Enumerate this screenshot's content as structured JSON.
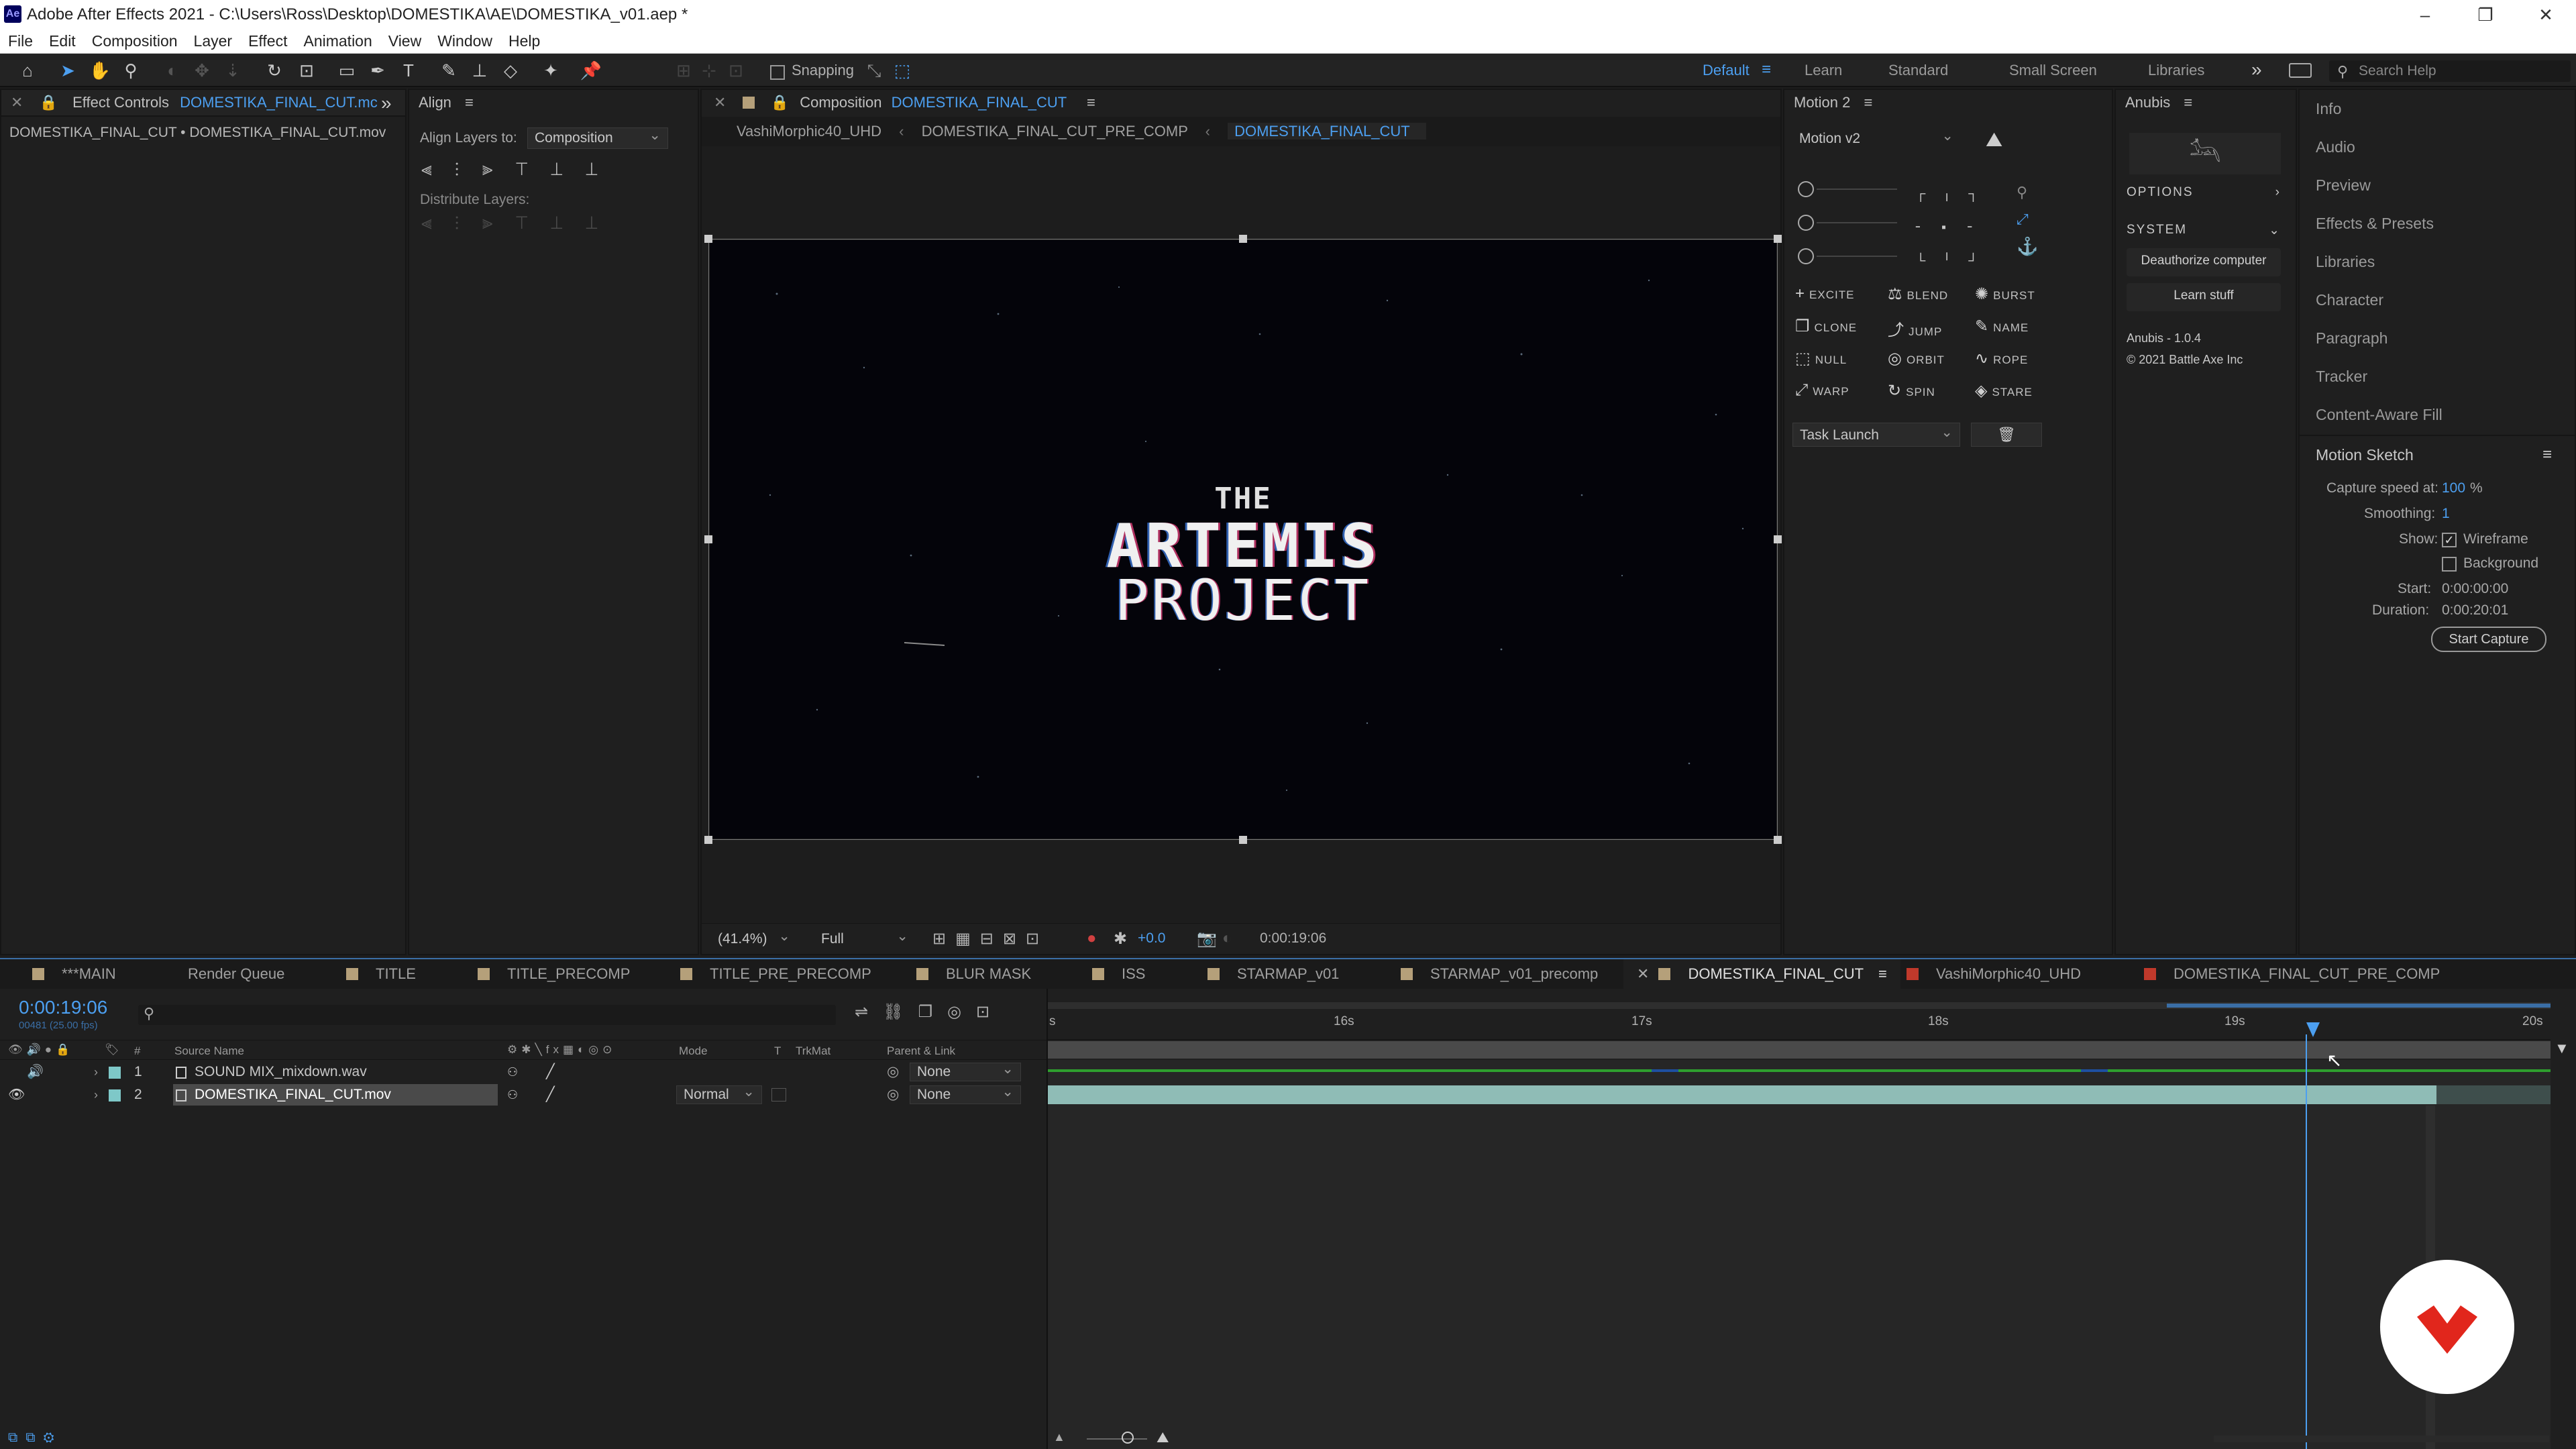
{
  "window": {
    "title": "Adobe After Effects 2021 - C:\\Users\\Ross\\Desktop\\DOMESTIKA\\AE\\DOMESTIKA_v01.aep *",
    "app_icon": "Ae",
    "minimize": "–",
    "restore": "❐",
    "close": "✕"
  },
  "menu": [
    "File",
    "Edit",
    "Composition",
    "Layer",
    "Effect",
    "Animation",
    "View",
    "Window",
    "Help"
  ],
  "toolbar": {
    "snapping": "Snapping",
    "workspaces": [
      "Default",
      "Learn",
      "Standard",
      "Small Screen",
      "Libraries"
    ],
    "active_workspace": "Default",
    "search_placeholder": "Search Help",
    "more": "»"
  },
  "effect_controls": {
    "tab_label": "Effect Controls",
    "tab_target": "DOMESTIKA_FINAL_CUT.mc",
    "subtitle": "DOMESTIKA_FINAL_CUT • DOMESTIKA_FINAL_CUT.mov"
  },
  "align": {
    "tab_label": "Align",
    "align_to_label": "Align Layers to:",
    "align_to_value": "Composition",
    "distribute_label": "Distribute Layers:"
  },
  "composition": {
    "tab_label": "Composition",
    "tab_target": "DOMESTIKA_FINAL_CUT",
    "breadcrumbs": [
      "VashiMorphic40_UHD",
      "DOMESTIKA_FINAL_CUT_PRE_COMP",
      "DOMESTIKA_FINAL_CUT"
    ],
    "active_breadcrumb": "DOMESTIKA_FINAL_CUT",
    "viewer_title_line1": "THE",
    "viewer_title_line2": "ARTEMIS",
    "viewer_title_line3": "PROJECT",
    "zoom": "(41.4%)",
    "resolution": "Full",
    "exposure": "+0.0",
    "timecode": "0:00:19:06"
  },
  "motion": {
    "tab_label": "Motion 2",
    "version": "Motion v2",
    "buttons": [
      {
        "icon": "+",
        "label": "EXCITE"
      },
      {
        "icon": "⚖",
        "label": "BLEND"
      },
      {
        "icon": "✺",
        "label": "BURST"
      },
      {
        "icon": "❐",
        "label": "CLONE"
      },
      {
        "icon": "⤴",
        "label": "JUMP"
      },
      {
        "icon": "✎",
        "label": "NAME"
      },
      {
        "icon": "⬚",
        "label": "NULL"
      },
      {
        "icon": "◎",
        "label": "ORBIT"
      },
      {
        "icon": "∿",
        "label": "ROPE"
      },
      {
        "icon": "⤢",
        "label": "WARP"
      },
      {
        "icon": "↻",
        "label": "SPIN"
      },
      {
        "icon": "◈",
        "label": "STARE"
      }
    ],
    "task_label": "Task Launch"
  },
  "anubis": {
    "tab_label": "Anubis",
    "options": "OPTIONS",
    "system": "SYSTEM",
    "deauthorize": "Deauthorize computer",
    "learn": "Learn stuff",
    "version": "Anubis - 1.0.4",
    "copyright": "© 2021 Battle Axe Inc"
  },
  "side_panels": [
    "Info",
    "Audio",
    "Preview",
    "Effects & Presets",
    "Libraries",
    "Character",
    "Paragraph",
    "Tracker",
    "Content-Aware Fill"
  ],
  "motion_sketch": {
    "title": "Motion Sketch",
    "capture_speed_label": "Capture speed at:",
    "capture_speed_value": "100",
    "capture_speed_unit": "%",
    "smoothing_label": "Smoothing:",
    "smoothing_value": "1",
    "show_label": "Show:",
    "wireframe": "Wireframe",
    "wireframe_checked": true,
    "background": "Background",
    "background_checked": false,
    "start_label": "Start:",
    "start_value": "0:00:00:00",
    "duration_label": "Duration:",
    "duration_value": "0:00:20:01",
    "start_capture": "Start Capture"
  },
  "timeline": {
    "tabs": [
      {
        "label": "MAIN",
        "prefix": "***",
        "color": "#b5a07a"
      },
      {
        "label": "Render Queue",
        "prefix": "",
        "color": ""
      },
      {
        "label": "TITLE",
        "prefix": "",
        "color": "#b5a07a"
      },
      {
        "label": "TITLE_PRECOMP",
        "prefix": "",
        "color": "#b5a07a"
      },
      {
        "label": "TITLE_PRE_PRECOMP",
        "prefix": "",
        "color": "#b5a07a"
      },
      {
        "label": "BLUR MASK",
        "prefix": "",
        "color": "#b5a07a"
      },
      {
        "label": "ISS",
        "prefix": "",
        "color": "#b5a07a"
      },
      {
        "label": "STARMAP_v01",
        "prefix": "",
        "color": "#b5a07a"
      },
      {
        "label": "STARMAP_v01_precomp",
        "prefix": "",
        "color": "#b5a07a"
      },
      {
        "label": "DOMESTIKA_FINAL_CUT",
        "prefix": "",
        "color": "#b5a07a"
      },
      {
        "label": "VashiMorphic40_UHD",
        "prefix": "",
        "color": "#c0392b"
      },
      {
        "label": "DOMESTIKA_FINAL_CUT_PRE_COMP",
        "prefix": "",
        "color": "#c0392b"
      }
    ],
    "active_tab": "DOMESTIKA_FINAL_CUT",
    "current_time": "0:00:19:06",
    "frame_info": "00481 (25.00 fps)",
    "columns": {
      "source": "Source Name",
      "mode": "Mode",
      "t": "T",
      "trkmat": "TrkMat",
      "parent": "Parent & Link",
      "num": "#"
    },
    "layers": [
      {
        "num": "1",
        "name": "SOUND MIX_mixdown.wav",
        "mode": "",
        "parent": "None",
        "selected": false
      },
      {
        "num": "2",
        "name": "DOMESTIKA_FINAL_CUT.mov",
        "mode": "Normal",
        "parent": "None",
        "selected": true
      }
    ],
    "ruler_labels": [
      "s",
      "16s",
      "17s",
      "18s",
      "19s",
      "20s"
    ]
  }
}
